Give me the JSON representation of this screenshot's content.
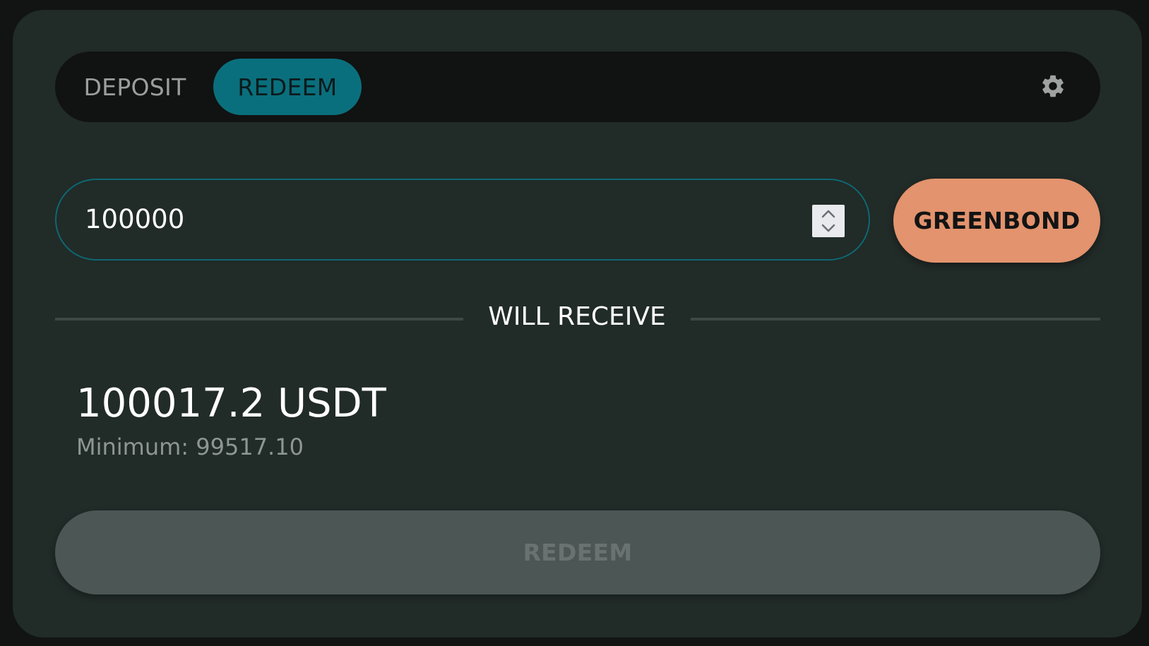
{
  "tabs": {
    "deposit_label": "DEPOSIT",
    "redeem_label": "REDEEM",
    "active": "REDEEM",
    "active_color": "#0a6f7c"
  },
  "settings": {
    "icon": "gear-icon"
  },
  "amount_input": {
    "value": "100000",
    "stepper_icon": "chevron-up-down-icon"
  },
  "token_selector": {
    "label": "GREENBOND",
    "color": "#e3936d"
  },
  "receive": {
    "divider_label": "WILL RECEIVE",
    "amount": "100017.2 USDT",
    "minimum": "Minimum: 99517.10"
  },
  "submit": {
    "label": "REDEEM",
    "disabled": true
  }
}
